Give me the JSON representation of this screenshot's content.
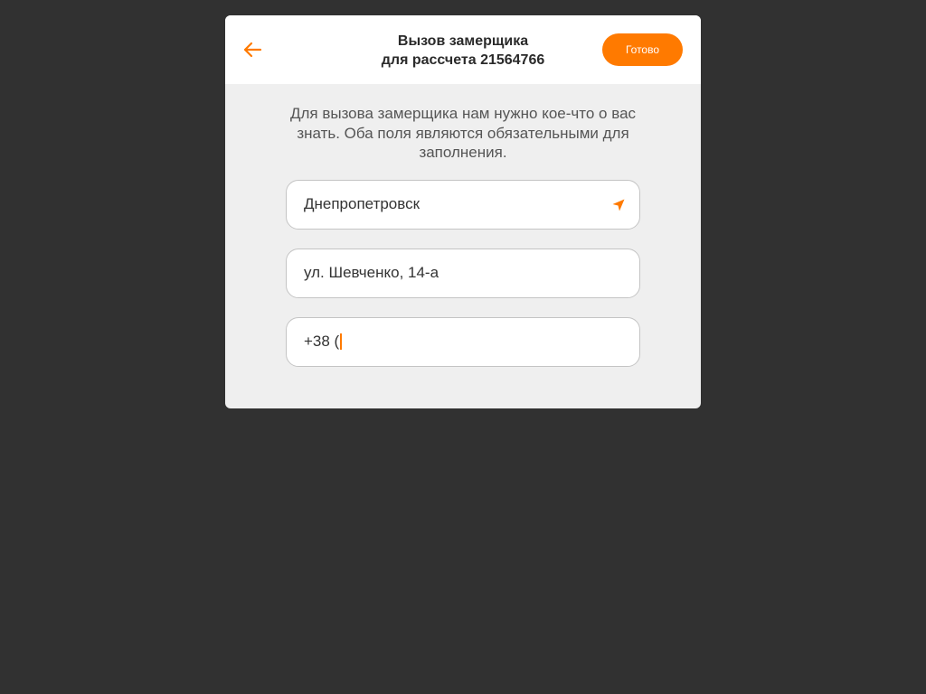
{
  "header": {
    "title_line1": "Вызов замерщика",
    "title_line2": "для рассчета 21564766",
    "back_icon": "arrow-left-icon",
    "done_label": "Готово"
  },
  "intro_text": "Для вызова замерщика нам нужно кое-что о вас знать. Оба поля являются обязательными для заполнения.",
  "fields": {
    "city": {
      "value": "Днепропетровск",
      "icon": "location-arrow-icon"
    },
    "street": {
      "value": "ул. Шевченко, 14-а"
    },
    "phone": {
      "value": "+38 ("
    }
  },
  "colors": {
    "accent": "#ff7a00",
    "backdrop": "#313131",
    "modal_body": "#efefef",
    "header_bg": "#ffffff"
  }
}
